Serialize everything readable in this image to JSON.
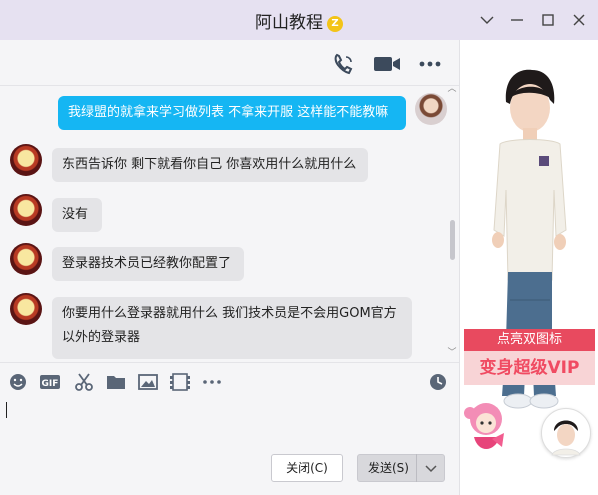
{
  "window": {
    "title": "阿山教程",
    "title_badge_icon": "qq-vip-badge-icon"
  },
  "chat_toolbar": {
    "icons": [
      "phone-icon",
      "video-call-icon",
      "more-icon"
    ]
  },
  "messages": [
    {
      "side": "out",
      "text": "我绿盟的就拿来学习做列表  不拿来开服 这样能不能教嘛"
    },
    {
      "side": "in",
      "text": "东西告诉你 剩下就看你自己 你喜欢用什么就用什么"
    },
    {
      "side": "in",
      "text": "没有"
    },
    {
      "side": "in",
      "text": "登录器技术员已经教你配置了"
    },
    {
      "side": "in",
      "text": "你要用什么登录器就用什么 我们技术员是不会用GOM官方",
      "text2": "以外的登录器"
    }
  ],
  "input_toolbar": {
    "icons": [
      "emoji-icon",
      "gif-icon",
      "scissors-icon",
      "folder-icon",
      "image-icon",
      "video-icon",
      "more-icon",
      "history-clock-icon"
    ]
  },
  "buttons": {
    "close_label": "关闭(C)",
    "send_label": "发送(S)"
  },
  "sidepanel": {
    "vip_top": "点亮双图标",
    "vip_bottom": "变身超级VIP"
  },
  "colors": {
    "titlebar": "#e6e1f1",
    "out_bubble": "#15b6f3",
    "in_bubble": "#e4e4e7",
    "vip_red": "#e84a5f"
  }
}
